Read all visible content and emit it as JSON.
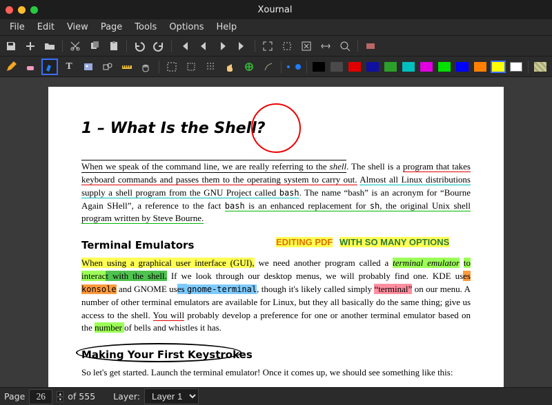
{
  "window": {
    "title": "Xournal"
  },
  "menus": [
    "File",
    "Edit",
    "View",
    "Page",
    "Tools",
    "Options",
    "Help"
  ],
  "toolbar1": {
    "save": "save",
    "new": "new",
    "open": "open",
    "cut": "cut",
    "copy": "copy",
    "paste": "paste",
    "undo": "undo",
    "redo": "redo",
    "first": "first-page",
    "prev": "prev-page",
    "next": "next-page",
    "last": "last-page",
    "fullscreen": "fullscreen",
    "zoom1": "zoom-100",
    "fit": "zoom-fit",
    "fitw": "zoom-width",
    "zoomout": "zoom-out",
    "toggle": "toolbar-toggle"
  },
  "toolbar2": {
    "tools": [
      "pencil",
      "eraser",
      "highlighter",
      "text",
      "image",
      "shapes",
      "ruler",
      "hand",
      "select-rect",
      "select-lasso",
      "select-vert",
      "pan",
      "recognize",
      "tex"
    ],
    "selected_tool": "highlighter",
    "thickness": [
      3,
      6
    ],
    "colors": [
      "#000000",
      "#4a4a4a",
      "#e00000",
      "#1010a0",
      "#2aa02a",
      "#00bfbf",
      "#e000e0",
      "#00e000",
      "#0000ff",
      "#ff8000",
      "#ffff00",
      "#ffffff"
    ],
    "selected_color": "#ffff00",
    "pattern": "pattern"
  },
  "document": {
    "h1": "1 – What Is the Shell?",
    "p1_a": "When we speak of the command line, we are really referring to the ",
    "p1_shell": "shell",
    "p1_b": ". The shell is a ",
    "p1_c": "program that takes keyboard commands and passes them to the operating system to carry ",
    "p1_d": "out.",
    "p1_e": " Almost all Linux distributions supply a shell program from the GNU Project called ",
    "p1_f": "bash",
    "p1_g": ". The name “bash” is an acronym for “Bourne Again SHell”, a reference to the fact ",
    "p1_h": "bash",
    "p1_i": " is an enhanced replacement for ",
    "p1_sh": "sh",
    "p1_j": ", the original Unix shell program written by Steve Bourne.",
    "ann_edit": "EDITING PDF",
    "ann_opts": "WITH SO MANY OPTIONS",
    "h2a": "Terminal Emulators",
    "p2_a": "When using a graphical user interface (GUI),",
    "p2_b": " we need another program called a ",
    "p2_term": "terminal emulator",
    "p2_c": " to interac",
    "p2_d": "t with the shell.",
    "p2_e": " If we look through our desktop menus, we will proba­bly find one. KDE us",
    "p2_f": "es ",
    "p2_kon": "konsole",
    "p2_g": " and GNOME us",
    "p2_h": "es ",
    "p2_gt": "gnome-terminal",
    "p2_i": ", though it's likely called simply ",
    "p2_tq": "“terminal”",
    "p2_j": " on our menu. A number of other terminal emulators are available for Linux, but they all basically do the same thing; give us access to the shell. ",
    "p2_k": "You will",
    "p2_l": " probably develop a preference for one or another terminal emulator based on the ",
    "p2_m": "number ",
    "p2_n": "of bells and whistles it has.",
    "h2b": "Making Your First Keystrokes",
    "p3": "So let's get started. Launch the terminal emulator! Once it comes up, we should see some­thing like this:"
  },
  "status": {
    "page_label": "Page",
    "page_current": "26",
    "page_total": "of 555",
    "layer_label": "Layer:",
    "layer_value": "Layer 1"
  }
}
